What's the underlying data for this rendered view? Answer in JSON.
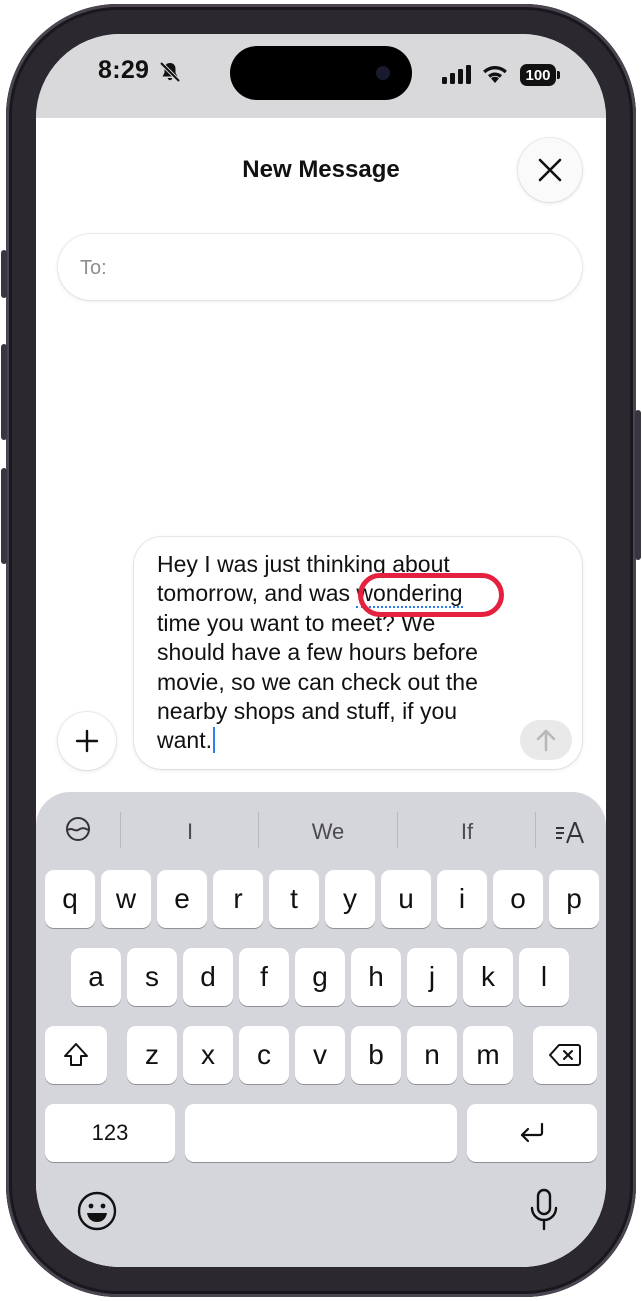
{
  "status_bar": {
    "time": "8:29",
    "battery": "100"
  },
  "header": {
    "title": "New Message",
    "close_icon": "close-icon"
  },
  "to_field": {
    "label": "To:"
  },
  "compose": {
    "text_lines": [
      "Hey I was just thinking about",
      "tomorrow, and was ",
      "time you want to meet? We",
      "should have a few hours before",
      "movie, so we can check out the",
      "nearby shops and stuff, if you",
      "want."
    ],
    "highlighted_word": "wondering"
  },
  "suggestions": {
    "items": [
      "I",
      "We",
      "If"
    ]
  },
  "keyboard": {
    "row1": [
      "q",
      "w",
      "e",
      "r",
      "t",
      "y",
      "u",
      "i",
      "o",
      "p"
    ],
    "row2": [
      "a",
      "s",
      "d",
      "f",
      "g",
      "h",
      "j",
      "k",
      "l"
    ],
    "row3": [
      "z",
      "x",
      "c",
      "v",
      "b",
      "n",
      "m"
    ],
    "numbers_key": "123"
  },
  "accent_colors": {
    "highlight_ring": "#e5213f",
    "caret": "#2f7df6"
  }
}
